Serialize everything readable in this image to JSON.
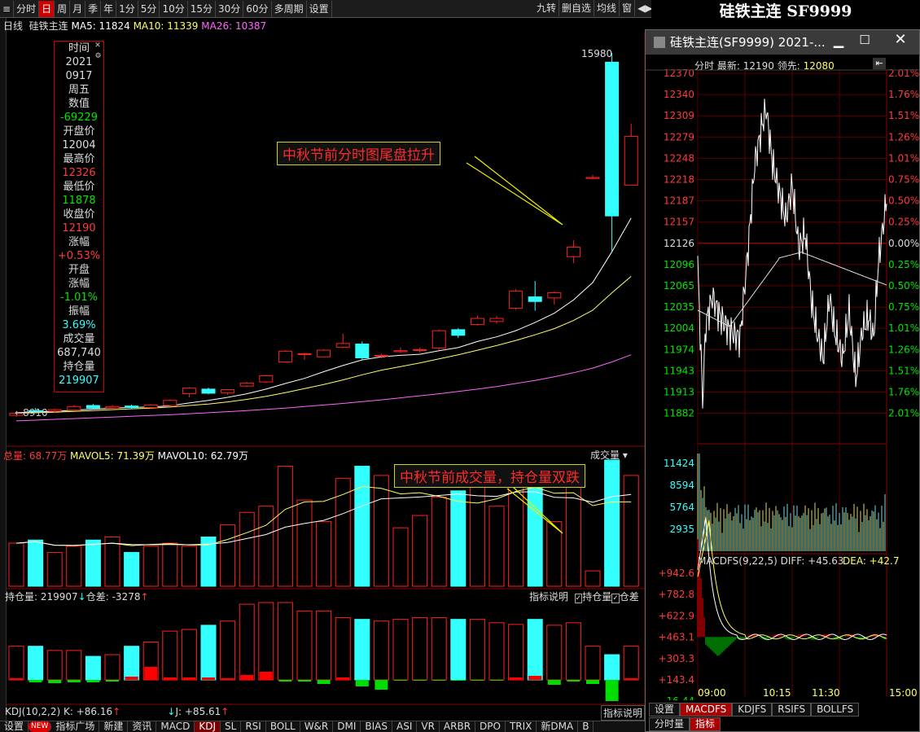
{
  "toolbar": {
    "periods": [
      "分时",
      "日",
      "周",
      "月",
      "季",
      "年",
      "1分",
      "5分",
      "10分",
      "15分",
      "30分",
      "60分",
      "多周期",
      "设置"
    ],
    "active_period": "日",
    "right_items": [
      "九转",
      "删自选",
      "均线",
      "窗"
    ]
  },
  "window_title": "硅铁主连 SF9999",
  "legend": {
    "period": "日线",
    "name": "硅铁主连",
    "ma5": "MA5: 11824",
    "ma10": "MA10: 11339",
    "ma26": "MA26: 10387"
  },
  "info": [
    {
      "text": "时间",
      "cls": "white"
    },
    {
      "text": "2021",
      "cls": "white"
    },
    {
      "text": "0917",
      "cls": "white"
    },
    {
      "text": "周五",
      "cls": "white"
    },
    {
      "text": "数值",
      "cls": "white"
    },
    {
      "text": "-69229",
      "cls": "green"
    },
    {
      "text": "开盘价",
      "cls": "white"
    },
    {
      "text": "12004",
      "cls": "white"
    },
    {
      "text": "最高价",
      "cls": "white"
    },
    {
      "text": "12326",
      "cls": "red"
    },
    {
      "text": "最低价",
      "cls": "white"
    },
    {
      "text": "11878",
      "cls": "green"
    },
    {
      "text": "收盘价",
      "cls": "white"
    },
    {
      "text": "12190",
      "cls": "red"
    },
    {
      "text": "涨幅",
      "cls": "white"
    },
    {
      "text": "+0.53%",
      "cls": "red"
    },
    {
      "text": "开盘",
      "cls": "white"
    },
    {
      "text": "涨幅",
      "cls": "white"
    },
    {
      "text": "-1.01%",
      "cls": "green"
    },
    {
      "text": "振幅",
      "cls": "white"
    },
    {
      "text": "3.69%",
      "cls": "cyan"
    },
    {
      "text": "成交量",
      "cls": "white"
    },
    {
      "text": "687,740",
      "cls": "white"
    },
    {
      "text": "持仓量",
      "cls": "white"
    },
    {
      "text": "219907",
      "cls": "cyan"
    }
  ],
  "price_high_label": "15980",
  "price_low_label": "8910",
  "annotation1": "中秋节前分时图尾盘拉升",
  "annotation2": "中秋节前成交量，持仓量双跌",
  "volume_legend": {
    "total": "总量: ",
    "total_val": "68.77万",
    "mavol5": "MAVOL5: 71.39万",
    "mavol10": "MAVOL10: 62.79万",
    "selector": "成交量"
  },
  "oi_legend": {
    "oi": "持仓量: 219907",
    "diff": "仓差: -3278",
    "explain": "指标说明",
    "cb1": "持仓量",
    "cb2": "仓差"
  },
  "kdj_legend": {
    "k": "KDJ(10,2,2) K: +86.16",
    "j": "J: +85.61",
    "explain": "指标说明"
  },
  "bottom_tabs": [
    "设置",
    "NEW",
    "指标广场",
    "新建",
    "资讯",
    "MACD",
    "KDJ",
    "SL",
    "RSI",
    "BOLL",
    "W&R",
    "DMI",
    "BIAS",
    "ASI",
    "VR",
    "ARBR",
    "DPO",
    "TRIX",
    "新DMA",
    "B"
  ],
  "bottom_active": "KDJ",
  "colors": {
    "up": "#ff2020",
    "down": "#33ffff",
    "ma5": "#ffffff",
    "ma10": "#ffff66",
    "ma26": "#ff66ff",
    "grid": "#8a0000"
  },
  "chart_data": {
    "type": "candlestick",
    "candles": [
      {
        "o": 8910,
        "h": 8980,
        "l": 8880,
        "c": 8950
      },
      {
        "o": 9000,
        "h": 9050,
        "l": 8960,
        "c": 8980
      },
      {
        "o": 8990,
        "h": 9040,
        "l": 8950,
        "c": 9020
      },
      {
        "o": 9010,
        "h": 9110,
        "l": 8990,
        "c": 9080
      },
      {
        "o": 9100,
        "h": 9130,
        "l": 9030,
        "c": 9050
      },
      {
        "o": 9050,
        "h": 9110,
        "l": 9020,
        "c": 9080
      },
      {
        "o": 9090,
        "h": 9120,
        "l": 9030,
        "c": 9060
      },
      {
        "o": 9060,
        "h": 9130,
        "l": 9040,
        "c": 9110
      },
      {
        "o": 9100,
        "h": 9220,
        "l": 9080,
        "c": 9200
      },
      {
        "o": 9330,
        "h": 9460,
        "l": 9260,
        "c": 9440
      },
      {
        "o": 9420,
        "h": 9450,
        "l": 9320,
        "c": 9340
      },
      {
        "o": 9350,
        "h": 9420,
        "l": 9310,
        "c": 9410
      },
      {
        "o": 9480,
        "h": 9560,
        "l": 9460,
        "c": 9540
      },
      {
        "o": 9560,
        "h": 9700,
        "l": 9540,
        "c": 9680
      },
      {
        "o": 9950,
        "h": 10180,
        "l": 9940,
        "c": 10160
      },
      {
        "o": 10110,
        "h": 10130,
        "l": 9990,
        "c": 10110
      },
      {
        "o": 10050,
        "h": 10200,
        "l": 10040,
        "c": 10180
      },
      {
        "o": 10240,
        "h": 10500,
        "l": 10220,
        "c": 10310
      },
      {
        "o": 10300,
        "h": 10350,
        "l": 9980,
        "c": 10030
      },
      {
        "o": 10080,
        "h": 10110,
        "l": 10020,
        "c": 10080
      },
      {
        "o": 10150,
        "h": 10230,
        "l": 10130,
        "c": 10170
      },
      {
        "o": 10180,
        "h": 10230,
        "l": 10130,
        "c": 10190
      },
      {
        "o": 10220,
        "h": 10580,
        "l": 10180,
        "c": 10560
      },
      {
        "o": 10580,
        "h": 10610,
        "l": 10420,
        "c": 10470
      },
      {
        "o": 10680,
        "h": 10850,
        "l": 10660,
        "c": 10800
      },
      {
        "o": 10740,
        "h": 10850,
        "l": 10700,
        "c": 10800
      },
      {
        "o": 11000,
        "h": 11370,
        "l": 10970,
        "c": 11330
      },
      {
        "o": 11220,
        "h": 11530,
        "l": 10950,
        "c": 11130
      },
      {
        "o": 11200,
        "h": 11330,
        "l": 11070,
        "c": 11300
      },
      {
        "o": 12004,
        "h": 12326,
        "l": 11878,
        "c": 12190
      },
      {
        "o": 13530,
        "h": 13600,
        "l": 13520,
        "c": 13550
      },
      {
        "o": 15800,
        "h": 15980,
        "l": 12100,
        "c": 12800
      },
      {
        "o": 13400,
        "h": 14600,
        "l": 13400,
        "c": 14350
      }
    ],
    "ma5": [
      8960,
      8975,
      8985,
      9010,
      9030,
      9050,
      9065,
      9070,
      9095,
      9150,
      9200,
      9260,
      9330,
      9420,
      9530,
      9630,
      9760,
      9880,
      9990,
      10050,
      10080,
      10100,
      10170,
      10230,
      10350,
      10440,
      10560,
      10720,
      10900,
      11160,
      11500,
      12100,
      12760
    ],
    "ma10": [
      8950,
      8960,
      8970,
      8985,
      9000,
      9020,
      9035,
      9050,
      9070,
      9100,
      9130,
      9170,
      9220,
      9280,
      9350,
      9430,
      9510,
      9600,
      9700,
      9790,
      9860,
      9930,
      10010,
      10090,
      10180,
      10270,
      10370,
      10480,
      10600,
      10760,
      10960,
      11300,
      11620
    ],
    "ma26": [
      8800,
      8815,
      8830,
      8845,
      8860,
      8875,
      8890,
      8905,
      8920,
      8940,
      8960,
      8980,
      9000,
      9025,
      9050,
      9080,
      9110,
      9140,
      9175,
      9210,
      9250,
      9290,
      9330,
      9375,
      9420,
      9470,
      9530,
      9590,
      9660,
      9740,
      9830,
      9950,
      10090
    ],
    "volume": [
      28,
      30,
      22,
      26,
      30,
      32,
      22,
      26,
      28,
      26,
      32,
      40,
      48,
      52,
      78,
      56,
      42,
      70,
      78,
      72,
      38,
      46,
      58,
      62,
      66,
      52,
      70,
      72,
      42,
      68,
      10,
      82,
      72
    ],
    "oi_bars": [
      40,
      40,
      35,
      35,
      28,
      30,
      40,
      45,
      58,
      60,
      65,
      70,
      90,
      92,
      92,
      82,
      82,
      74,
      72,
      70,
      72,
      74,
      74,
      72,
      72,
      68,
      66,
      72,
      65,
      68,
      40,
      30,
      40
    ],
    "oi_diff": [
      2,
      -3,
      -4,
      -3,
      -3,
      -2,
      4,
      16,
      3,
      3,
      3,
      2,
      6,
      10,
      -2,
      -2,
      -5,
      3,
      -8,
      -12,
      -1,
      -1,
      -1,
      -1,
      -1,
      -1,
      3,
      5,
      -6,
      -2,
      -5,
      -26,
      2
    ]
  },
  "popup": {
    "title": "硅铁主连(SF9999) 2021-...",
    "info_prefix": "分时 最新: ",
    "info_last": "12190",
    "info_mid": " 领先: ",
    "info_lead": "12080",
    "prices": [
      "12370",
      "12340",
      "12309",
      "12279",
      "12248",
      "12218",
      "12187",
      "12157",
      "12126",
      "12096",
      "12065",
      "12035",
      "12004",
      "11974",
      "11943",
      "11913",
      "11882"
    ],
    "pcts": [
      "2.01%",
      "1.76%",
      "1.51%",
      "1.26%",
      "1.01%",
      "0.75%",
      "0.50%",
      "0.25%",
      "0.00%",
      "0.25%",
      "0.50%",
      "0.75%",
      "1.01%",
      "1.26%",
      "1.51%",
      "1.76%",
      "2.01%"
    ],
    "vol_labels": [
      "11424",
      "8594",
      "5764",
      "2935"
    ],
    "macd_legend": "MACDFS(9,22,5) DIFF: +45.63",
    "macd_dea": "DEA: +42.7",
    "macd_labels": [
      "+942.6",
      "+782.8",
      "+622.9",
      "+463.1",
      "+303.3",
      "+143.4",
      "-16.44"
    ],
    "times": [
      "09:00",
      "10:15",
      "11:30",
      "15:00"
    ],
    "tabs": [
      "设置",
      "MACDFS",
      "KDJFS",
      "RSIFS",
      "BOLLFS"
    ],
    "active_tab": "MACDFS",
    "tabs2": [
      "分时量",
      "指标"
    ],
    "active_tab2": "指标",
    "close_price": "12126"
  }
}
